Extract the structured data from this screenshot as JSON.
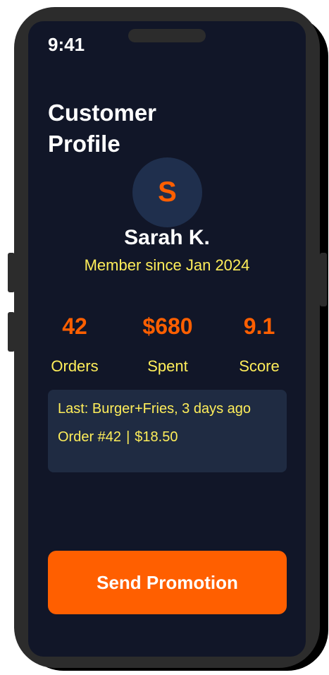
{
  "status_bar": {
    "time": "9:41"
  },
  "header": {
    "title": "Customer Profile"
  },
  "customer": {
    "initial": "S",
    "name": "Sarah K.",
    "member_since": "Member since Jan 2024"
  },
  "stats": [
    {
      "value": "42",
      "label": "Orders"
    },
    {
      "value": "$680",
      "label": "Spent"
    },
    {
      "value": "9.1",
      "label": "Score"
    }
  ],
  "last_order": {
    "summary": "Last: Burger+Fries, 3 days ago",
    "order_number": "Order #42",
    "separator": "|",
    "amount": "$18.50"
  },
  "actions": {
    "send_promotion_label": "Send Promotion"
  },
  "colors": {
    "background": "#111628",
    "accent": "#ff5f00",
    "highlight_text": "#ffee5a",
    "card": "#1f2b42",
    "avatar_bg": "#1f2f4d"
  }
}
